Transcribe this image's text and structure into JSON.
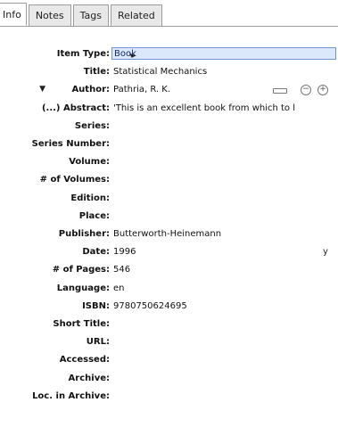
{
  "tabs": {
    "info": "Info",
    "notes": "Notes",
    "tags": "Tags",
    "related": "Related"
  },
  "fields": {
    "item_type": {
      "label": "Item Type:",
      "value": "Book"
    },
    "title": {
      "label": "Title:",
      "value": "Statistical Mechanics"
    },
    "author": {
      "label": "Author:",
      "value": "Pathria, R. K."
    },
    "abstract": {
      "label": "(...) Abstract:",
      "value": "'This is an excellent book from which to l"
    },
    "series": {
      "label": "Series:",
      "value": ""
    },
    "series_number": {
      "label": "Series Number:",
      "value": ""
    },
    "volume": {
      "label": "Volume:",
      "value": ""
    },
    "num_volumes": {
      "label": "# of Volumes:",
      "value": ""
    },
    "edition": {
      "label": "Edition:",
      "value": ""
    },
    "place": {
      "label": "Place:",
      "value": ""
    },
    "publisher": {
      "label": "Publisher:",
      "value": "Butterworth-Heinemann"
    },
    "date": {
      "label": "Date:",
      "value": "1996",
      "flag": "y"
    },
    "num_pages": {
      "label": "# of Pages:",
      "value": "546"
    },
    "language": {
      "label": "Language:",
      "value": "en"
    },
    "isbn": {
      "label": "ISBN:",
      "value": "9780750624695"
    },
    "short_title": {
      "label": "Short Title:",
      "value": ""
    },
    "url": {
      "label": "URL:",
      "value": ""
    },
    "accessed": {
      "label": "Accessed:",
      "value": ""
    },
    "archive": {
      "label": "Archive:",
      "value": ""
    },
    "loc_in_archive": {
      "label": "Loc. in Archive:",
      "value": ""
    }
  },
  "icons": {
    "author_collapse": "triangle-down-icon",
    "author_switch": "field-mode-switch-icon",
    "author_remove": "minus-icon",
    "author_add": "plus-icon"
  },
  "colors": {
    "selected_field_bg": "#dbe7fb",
    "selected_field_border": "#6e93d8"
  }
}
